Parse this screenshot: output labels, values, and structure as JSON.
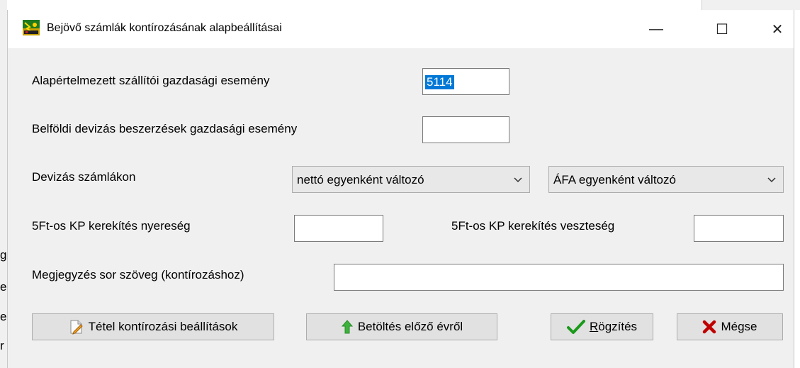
{
  "window": {
    "title": "Bejövő számlák kontírozásának alapbeállításai",
    "controls": {
      "minimize": "—",
      "maximize": "☐",
      "close": "✕"
    }
  },
  "background_fragments": [
    "g",
    "e",
    "e",
    "r"
  ],
  "form": {
    "default_supplier_event": {
      "label": "Alapértelmezett szállítói gazdasági esemény",
      "value": "5114"
    },
    "domestic_fx_event": {
      "label": "Belföldi devizás beszerzések gazdasági esemény",
      "value": ""
    },
    "fx_invoices": {
      "label": "Devizás számlákon",
      "net_option": "nettó egyenként változó",
      "vat_option": "ÁFA egyenként változó"
    },
    "rounding_gain": {
      "label": "5Ft-os KP kerekítés nyereség",
      "value": ""
    },
    "rounding_loss": {
      "label": "5Ft-os KP kerekítés veszteség",
      "value": ""
    },
    "note_line": {
      "label": "Megjegyzés sor szöveg (kontírozáshoz)",
      "value": ""
    }
  },
  "buttons": {
    "item_settings": "Tétel kontírozási beállítások",
    "load_previous": "Betöltés előző évről",
    "save_hotkey": "R",
    "save_rest": "ögzítés",
    "cancel": "Mégse"
  },
  "colors": {
    "selection": "#0078d7",
    "dialog_bg": "#f0f0f0",
    "button_bg": "#e1e1e1",
    "check_green": "#1a9a1a",
    "cancel_red": "#c00000",
    "arrow_green": "#3cb43c"
  }
}
